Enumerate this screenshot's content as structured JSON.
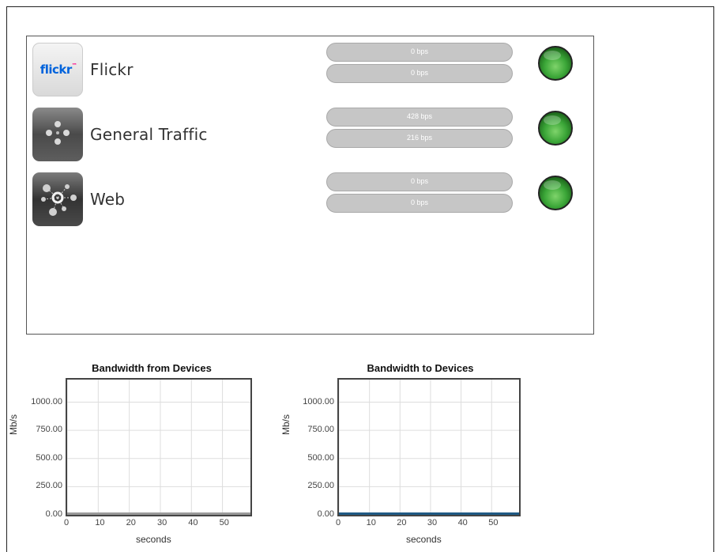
{
  "apps": [
    {
      "name": "Flickr",
      "icon": "flickr-logo-icon",
      "upload": "0 bps",
      "download": "0 bps",
      "status": "active",
      "logo_text": {
        "a": "flickr",
        "b": "™"
      }
    },
    {
      "name": "General Traffic",
      "icon": "network-nodes-icon",
      "upload": "428 bps",
      "download": "216 bps",
      "status": "active"
    },
    {
      "name": "Web",
      "icon": "web-hub-icon",
      "upload": "0 bps",
      "download": "0 bps",
      "status": "active"
    }
  ],
  "colors": {
    "status_green": "#3aa537",
    "pill_gray": "#c6c6c6",
    "series_line": "#1f5a84",
    "flickr_blue": "#0063dc",
    "flickr_pink": "#ff0084"
  },
  "chart_data": [
    {
      "type": "line",
      "title": "Bandwidth from Devices",
      "xlabel": "seconds",
      "ylabel": "Mb/s",
      "xlim": [
        0,
        59
      ],
      "ylim": [
        0,
        1200
      ],
      "x_ticks": [
        "0",
        "10",
        "20",
        "30",
        "40",
        "50"
      ],
      "y_ticks": [
        "0.00",
        "250.00",
        "500.00",
        "750.00",
        "1000.00"
      ],
      "grid": true,
      "series": [
        {
          "x": [
            0,
            59
          ],
          "y": [
            0,
            0
          ],
          "color": "#9a9a9a"
        }
      ]
    },
    {
      "type": "line",
      "title": "Bandwidth to Devices",
      "xlabel": "seconds",
      "ylabel": "Mb/s",
      "xlim": [
        0,
        59
      ],
      "ylim": [
        0,
        1200
      ],
      "x_ticks": [
        "0",
        "10",
        "20",
        "30",
        "40",
        "50"
      ],
      "y_ticks": [
        "0.00",
        "250.00",
        "500.00",
        "750.00",
        "1000.00"
      ],
      "grid": true,
      "series": [
        {
          "x": [
            0,
            59
          ],
          "y": [
            0,
            0
          ],
          "color": "#1f5a84"
        }
      ]
    }
  ]
}
